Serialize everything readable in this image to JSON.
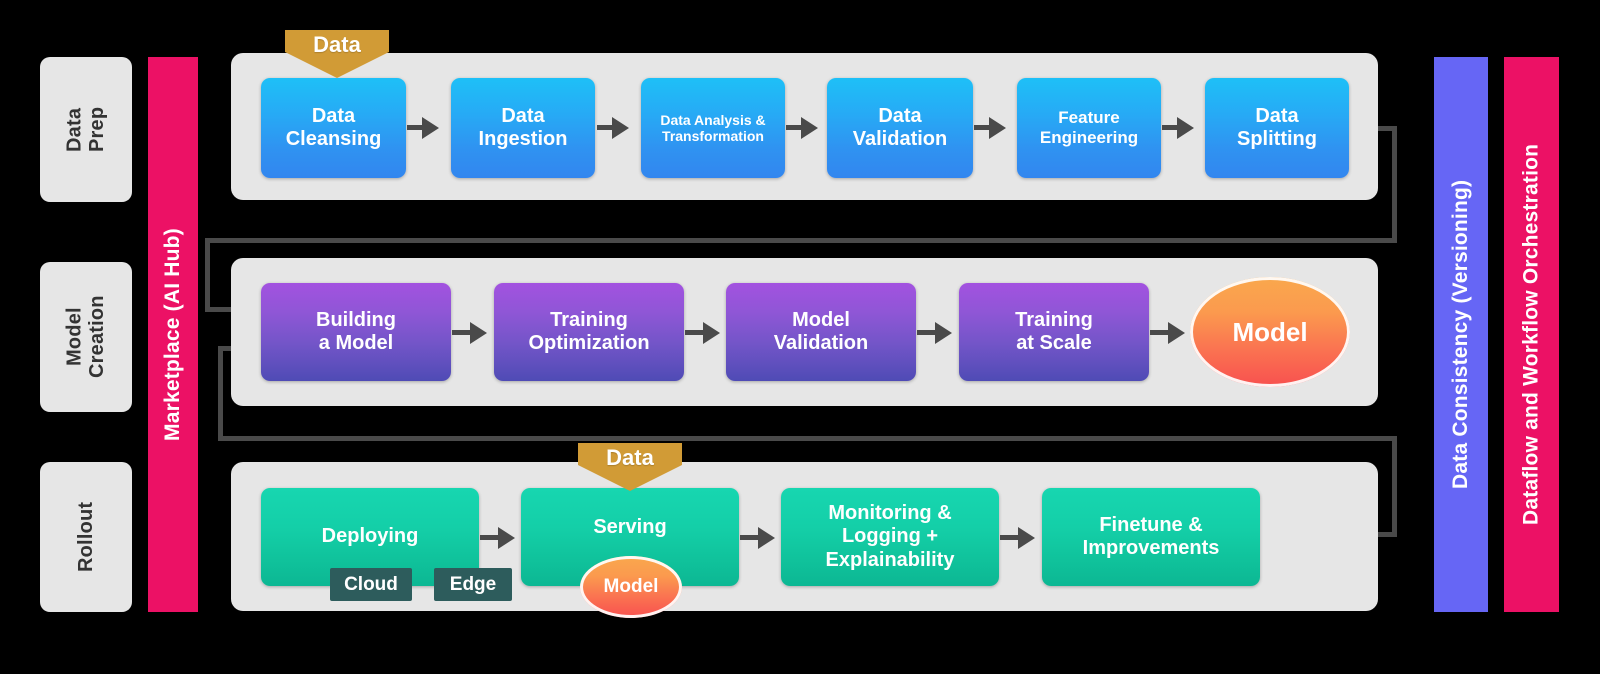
{
  "stages": [
    {
      "id": "data-prep",
      "label": "Data\nPrep"
    },
    {
      "id": "model-creation",
      "label": "Model\nCreation"
    },
    {
      "id": "rollout",
      "label": "Rollout"
    }
  ],
  "pillars": {
    "left": {
      "label": "Marketplace (AI Hub)",
      "color": "#ec1165"
    },
    "right_inner": {
      "label": "Data Consistency (Versioning)",
      "color": "#6666f5"
    },
    "right_outer": {
      "label": "Dataflow and Workflow Orchestration",
      "color": "#ec1165"
    }
  },
  "rows": {
    "data_prep": {
      "steps": [
        {
          "label": "Data\nCleansing",
          "size": "f20"
        },
        {
          "label": "Data\nIngestion",
          "size": "f20"
        },
        {
          "label": "Data Analysis &\nTransformation",
          "size": "f14"
        },
        {
          "label": "Data\nValidation",
          "size": "f20"
        },
        {
          "label": "Feature\nEngineering",
          "size": "f17"
        },
        {
          "label": "Data\nSplitting",
          "size": "f20"
        }
      ],
      "input_banner": "Data"
    },
    "model_creation": {
      "steps": [
        {
          "label": "Building\na Model",
          "size": "f20"
        },
        {
          "label": "Training\nOptimization",
          "size": "f20"
        },
        {
          "label": "Model\nValidation",
          "size": "f20"
        },
        {
          "label": "Training\nat Scale",
          "size": "f20"
        }
      ],
      "artifact": "Model"
    },
    "rollout": {
      "steps": [
        {
          "label": "Deploying",
          "size": "f20"
        },
        {
          "label": "Serving",
          "size": "f20"
        },
        {
          "label": "Monitoring &\nLogging +\nExplainability",
          "size": "f20"
        },
        {
          "label": "Finetune &\nImprovements",
          "size": "f20"
        }
      ],
      "tags": [
        "Cloud",
        "Edge"
      ],
      "input_banner": "Data",
      "artifact": "Model"
    }
  },
  "colors": {
    "accent_pink": "#ec1165",
    "accent_blue_pillar": "#6666f5",
    "box_blue": "#27a9f5",
    "box_purple": "#8f56d6",
    "box_teal": "#14cfa8",
    "artifact_orange": "#fb9a4e",
    "banner_gold": "#d19b36",
    "band_gray": "#e6e6e6",
    "connector_gray": "#4a4a4a",
    "tag_dark_teal": "#2d5c5c"
  }
}
